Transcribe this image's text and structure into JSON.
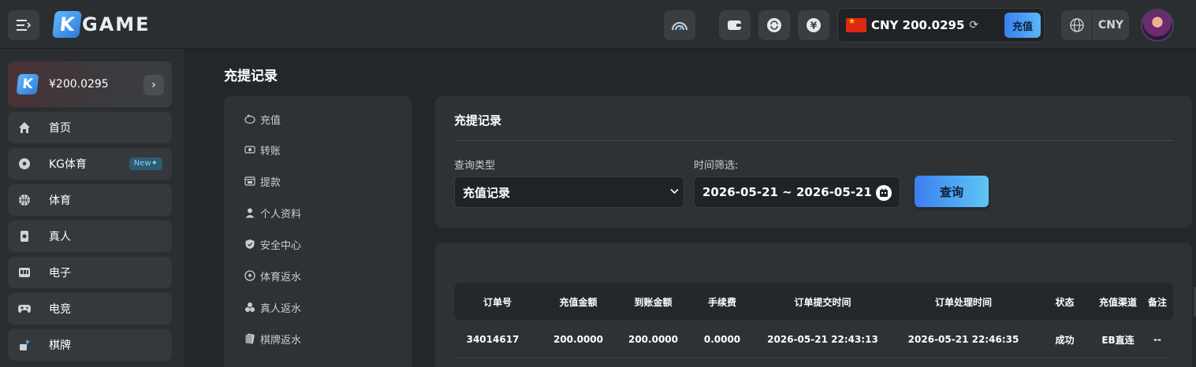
{
  "header": {
    "logo_text": "GAME",
    "logo_letter": "K",
    "balance": "CNY 200.0295",
    "recharge_label": "充值",
    "currency": "CNY",
    "colors": {
      "accent": "#4a90f0",
      "background": "#24272a"
    }
  },
  "sidebar": {
    "wallet_amount": "¥200.0295",
    "wallet_letter": "K",
    "items": [
      {
        "label": "首页",
        "icon": "home-icon"
      },
      {
        "label": "KG体育",
        "icon": "soccer-ball-icon",
        "badge": "New✦"
      },
      {
        "label": "体育",
        "icon": "basketball-icon"
      },
      {
        "label": "真人",
        "icon": "cards-icon"
      },
      {
        "label": "电子",
        "icon": "slot-machine-icon"
      },
      {
        "label": "电竞",
        "icon": "gamepad-icon"
      },
      {
        "label": "棋牌",
        "icon": "chess-icon"
      }
    ]
  },
  "page": {
    "title": "充提记录"
  },
  "subnav": {
    "items": [
      {
        "label": "充值",
        "icon": "piggy-bank-icon"
      },
      {
        "label": "转账",
        "icon": "transfer-icon"
      },
      {
        "label": "提款",
        "icon": "withdraw-icon"
      },
      {
        "label": "个人资料",
        "icon": "user-icon"
      },
      {
        "label": "安全中心",
        "icon": "shield-icon"
      },
      {
        "label": "体育返水",
        "icon": "soccer-ball-icon"
      },
      {
        "label": "真人返水",
        "icon": "poker-chips-icon"
      },
      {
        "label": "棋牌返水",
        "icon": "card-icon"
      }
    ]
  },
  "filter": {
    "title": "充提记录",
    "type_label": "查询类型",
    "type_value": "充值记录",
    "time_label": "时间筛选:",
    "date_range": "2026-05-21 ~ 2026-05-21",
    "query_label": "查询"
  },
  "table": {
    "headers": [
      "订单号",
      "充值金额",
      "到账金额",
      "手续费",
      "订单提交时间",
      "订单处理时间",
      "状态",
      "充值渠道",
      "备注"
    ],
    "rows": [
      [
        "34014617",
        "200.0000",
        "200.0000",
        "0.0000",
        "2026-05-21 22:43:13",
        "2026-05-21 22:46:35",
        "成功",
        "EB直连",
        "--"
      ]
    ]
  }
}
